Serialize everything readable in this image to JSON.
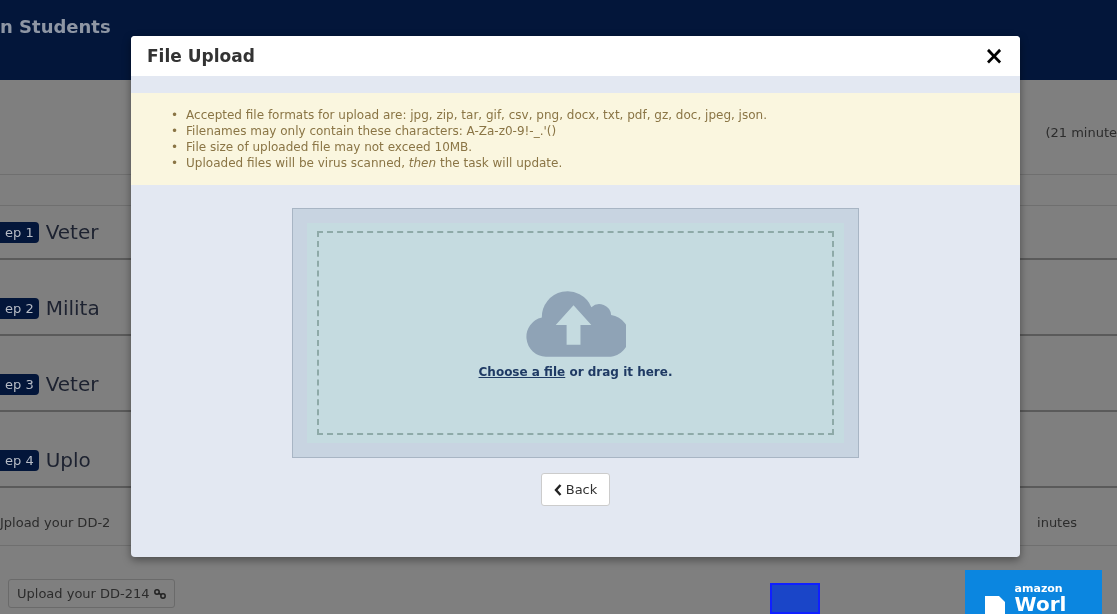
{
  "page": {
    "header_title": "n Students",
    "time_note": "(21 minute",
    "steps": [
      {
        "badge": "ep 1",
        "title": "Veter"
      },
      {
        "badge": "ep 2",
        "title": "Milita"
      },
      {
        "badge": "ep 3",
        "title": "Veter"
      },
      {
        "badge": "ep 4",
        "title": "Uplo"
      }
    ],
    "upload_text": "Jpload your DD-2",
    "upload_minutes": "inutes",
    "upload_button": "Upload your DD-214",
    "ad": {
      "brand": "amazon",
      "word": "Worl"
    }
  },
  "dialog": {
    "title": "File Upload",
    "close": "×",
    "notices": [
      {
        "bullet": "•",
        "text": "Accepted file formats for upload are: jpg, zip, tar, gif, csv, png, docx, txt, pdf, gz, doc, jpeg, json."
      },
      {
        "bullet": "•",
        "text": "Filenames may only contain these characters: A-Za-z0-9!-_.'()"
      },
      {
        "bullet": "•",
        "text": "File size of uploaded file may not exceed 10MB."
      },
      {
        "bullet": "•",
        "text": "Uploaded files will be virus scanned, *then* the task will update."
      }
    ],
    "drop_zone": {
      "link": "Choose a file",
      "rest": " or drag it here."
    },
    "back_button": "Back"
  }
}
